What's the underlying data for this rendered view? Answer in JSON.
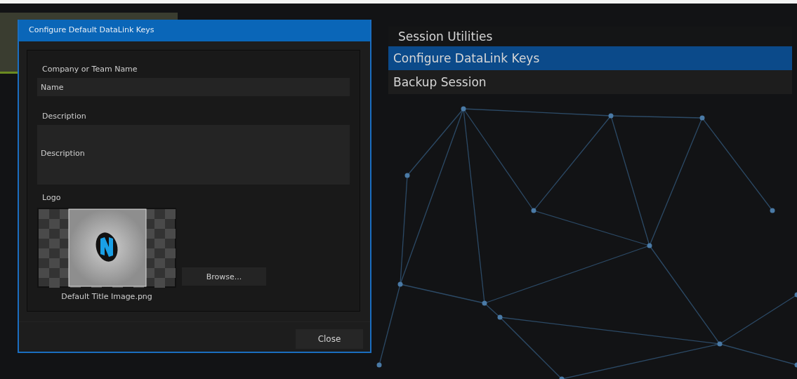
{
  "dialog": {
    "title": "Configure Default DataLink Keys",
    "fields": [
      {
        "label": "Company or Team Name",
        "placeholder": "Name",
        "kind": "line"
      },
      {
        "label": "Description",
        "placeholder": "Description",
        "kind": "area"
      }
    ],
    "logo": {
      "label": "Logo",
      "filename": "Default Title Image.png",
      "browse_button": "Browse..."
    },
    "close_button": "Close"
  },
  "menu": {
    "title": "Session Utilities",
    "items": [
      {
        "label": "Configure DataLink Keys",
        "selected": true
      },
      {
        "label": "Backup Session",
        "selected": false
      }
    ]
  }
}
